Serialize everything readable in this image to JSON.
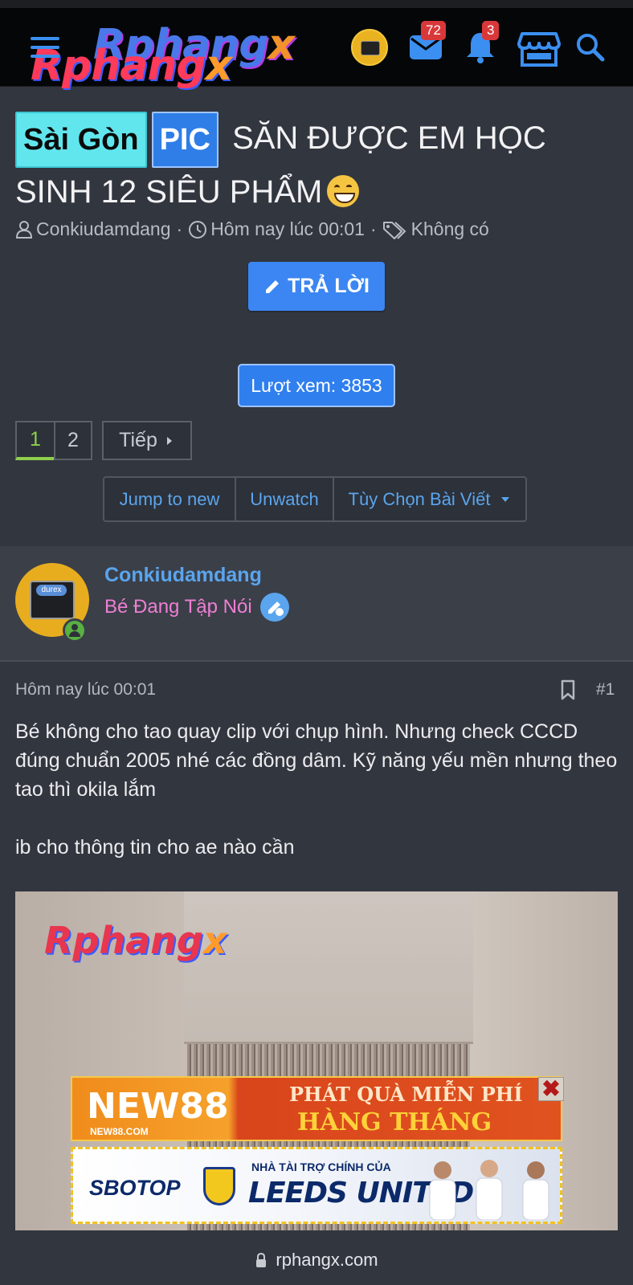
{
  "header": {
    "logo_text": "Rphangx",
    "inbox_count": "72",
    "alerts_count": "3"
  },
  "thread": {
    "prefix_region": "Sài Gòn",
    "prefix_type": "PIC",
    "title_line1": "SĂN ĐƯỢC EM HỌC",
    "title_line2": "SINH 12 SIÊU PHẨM",
    "author": "Conkiudamdang",
    "posted": "Hôm nay lúc 00:01",
    "tags": "Không có",
    "reply_label": "TRẢ LỜI",
    "views_label": "Lượt xem: 3853"
  },
  "pagination": {
    "pages": [
      "1",
      "2"
    ],
    "current": "1",
    "next_label": "Tiếp"
  },
  "thread_actions": {
    "jump": "Jump to new",
    "unwatch": "Unwatch",
    "options": "Tùy Chọn Bài Viết"
  },
  "post": {
    "username": "Conkiudamdang",
    "rank": "Bé Đang Tập Nói",
    "date": "Hôm nay lúc 00:01",
    "number": "#1",
    "paragraph1": "Bé không cho tao quay clip với chụp hình. Nhưng check CCCD đúng chuẩn 2005 nhé các đồng dâm. Kỹ năng yếu mền nhưng theo tao thì okila lắm",
    "paragraph2": "ib cho thông tin cho ae nào cần",
    "image_watermark": "Rphangx"
  },
  "ads": {
    "ad1_brand": "NEW88",
    "ad1_site": "NEW88.COM",
    "ad1_line1": "PHÁT QUÀ MIỄN PHÍ",
    "ad1_line2": "HÀNG THÁNG",
    "ad2_brand": "SBOTOP",
    "ad2_small": "NHÀ TÀI TRỢ CHÍNH CỦA",
    "ad2_big": "LEEDS UNITED"
  },
  "browser": {
    "url": "rphangx.com"
  },
  "colors": {
    "accent": "#3b86f2",
    "link": "#5aa5ee",
    "rank": "#ee7fd4",
    "online": "#59b043",
    "page_current": "#8fcf4b"
  }
}
